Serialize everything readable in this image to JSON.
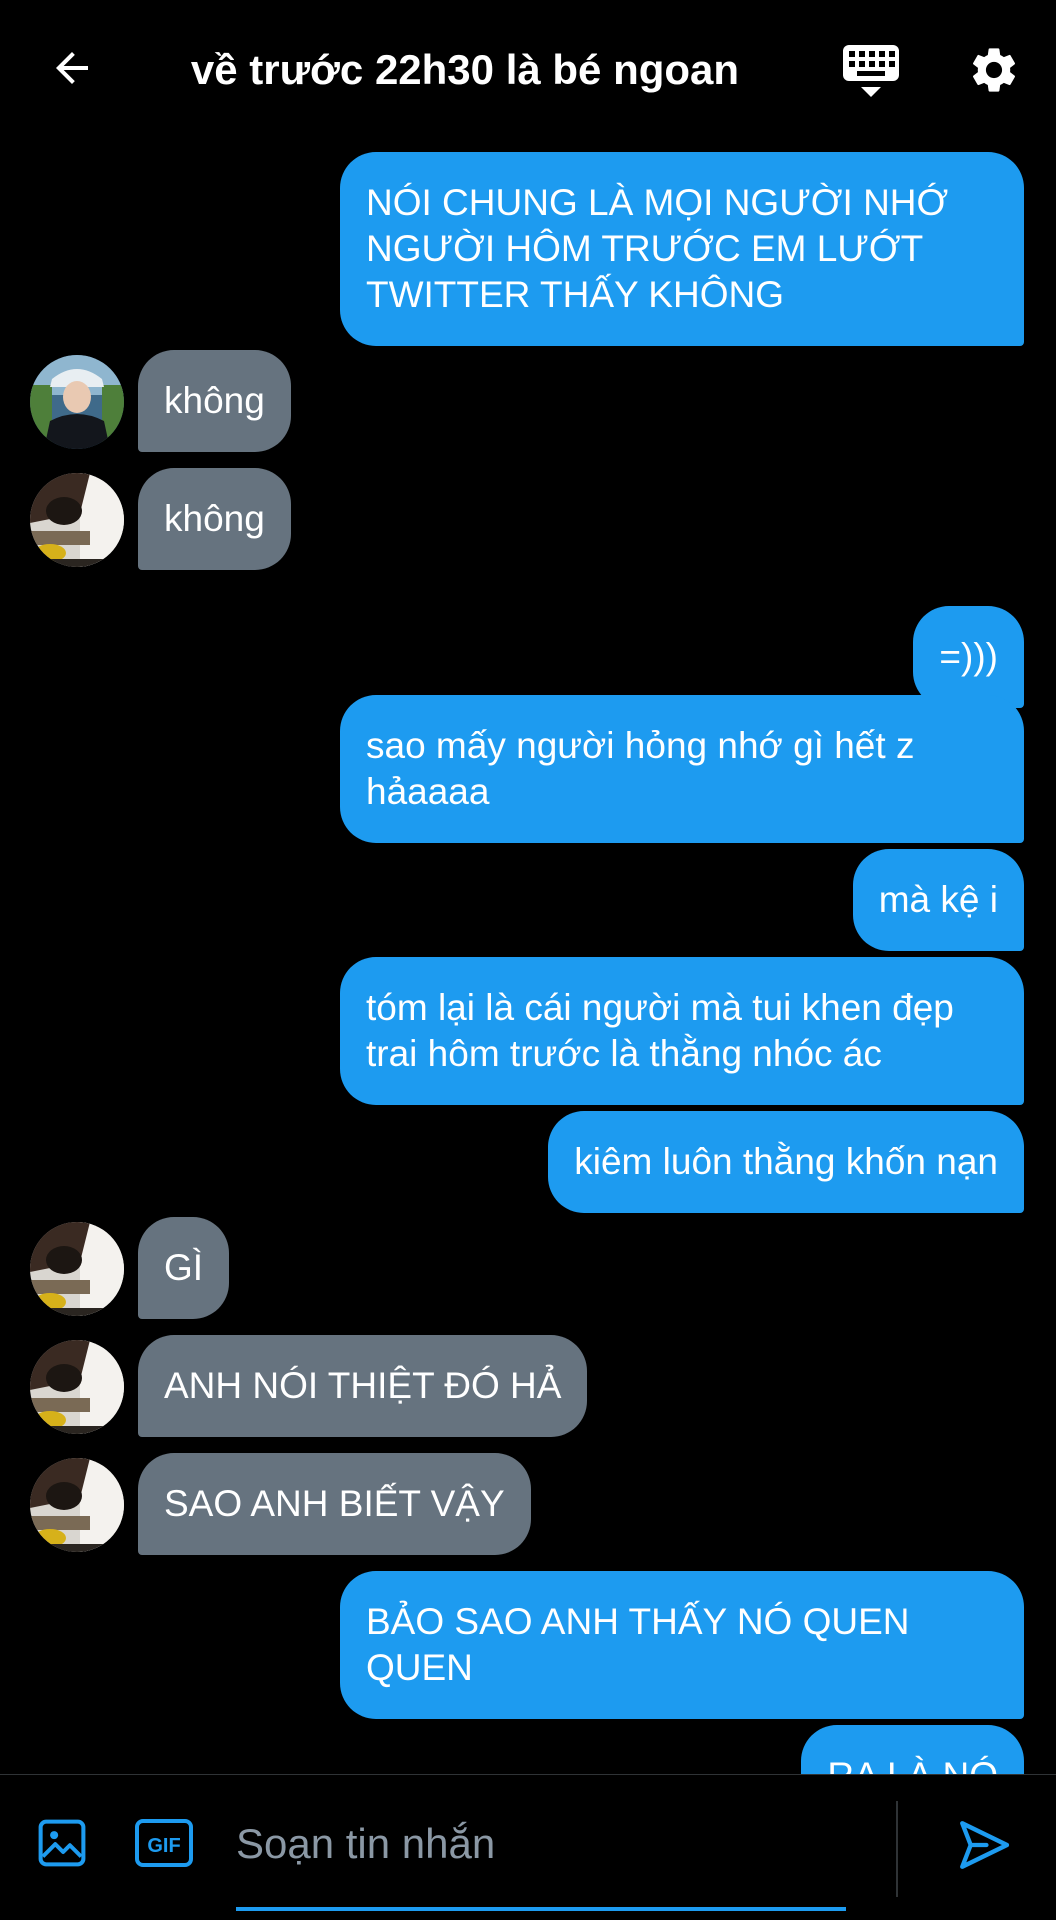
{
  "header": {
    "title": "về trước 22h30 là bé ngoan",
    "back_icon": "arrow-left-icon",
    "keyboard_icon": "keyboard-icon",
    "settings_icon": "gear-icon"
  },
  "messages": [
    {
      "direction": "out",
      "text": "NÓI CHUNG LÀ MỌI NGƯỜI NHỚ\nNGƯỜI HÔM TRƯỚC EM LƯỚT\nTWITTER THẤY KHÔNG"
    },
    {
      "direction": "in",
      "text": "không",
      "avatar": "avatar-user-a"
    },
    {
      "direction": "in",
      "text": "không",
      "avatar": "avatar-user-b"
    },
    {
      "direction": "out",
      "text": "=)))"
    },
    {
      "direction": "out",
      "text": "sao mấy người hỏng nhớ gì hết z\nhảaaaa"
    },
    {
      "direction": "out",
      "text": "mà kệ i"
    },
    {
      "direction": "out",
      "text": "tóm lại là cái người mà tui khen đẹp\ntrai hôm trước là thằng nhóc ác"
    },
    {
      "direction": "out",
      "text": "kiêm luôn thằng khốn nạn"
    },
    {
      "direction": "in",
      "text": "GÌ",
      "avatar": "avatar-user-b"
    },
    {
      "direction": "in",
      "text": "ANH NÓI THIỆT ĐÓ HẢ",
      "avatar": "avatar-user-b"
    },
    {
      "direction": "in",
      "text": "SAO ANH BIẾT VẬY",
      "avatar": "avatar-user-b"
    },
    {
      "direction": "out",
      "text": "BẢO SAO ANH THẤY NÓ QUEN\nQUEN"
    },
    {
      "direction": "out",
      "text": "RA LÀ NÓ"
    }
  ],
  "composer": {
    "placeholder": "Soạn tin nhắn",
    "value": "",
    "photo_icon": "image-icon",
    "gif_label": "GIF",
    "send_icon": "send-icon"
  },
  "colors": {
    "background": "#000000",
    "outgoing_bubble": "#1d9bf0",
    "incoming_bubble": "#66737f",
    "accent": "#1d9bf0"
  }
}
